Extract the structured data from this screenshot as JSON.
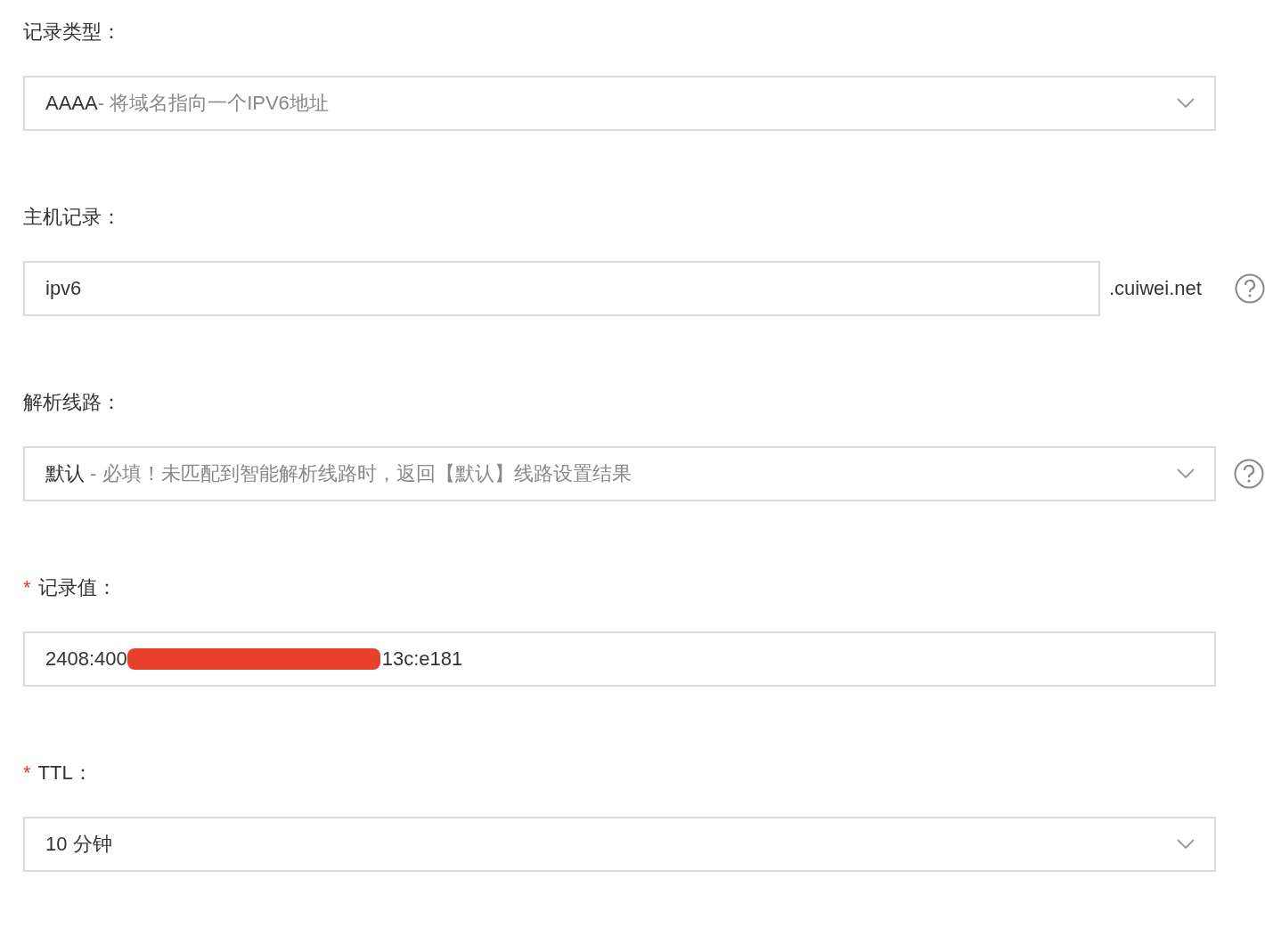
{
  "fields": [
    {
      "kind": "select",
      "label": "记录类型：",
      "value_code": "AAAA",
      "value_description": "- 将域名指向一个IPV6地址",
      "help": false
    },
    {
      "kind": "input",
      "label": "主机记录：",
      "value": "ipv6",
      "suffix": ".cuiwei.net",
      "help": true
    },
    {
      "kind": "select",
      "label": "解析线路：",
      "value_code": "默认",
      "value_description": " - 必填！未匹配到智能解析线路时，返回【默认】线路设置结果",
      "help": true
    },
    {
      "kind": "redacted_input",
      "required_mark": "*",
      "label": "记录值：",
      "value_start": "2408:400",
      "value_end": "13c:e181",
      "help": false
    },
    {
      "kind": "select",
      "required_mark": "*",
      "label": "TTL：",
      "value_code": "10 分钟",
      "help": false
    }
  ]
}
